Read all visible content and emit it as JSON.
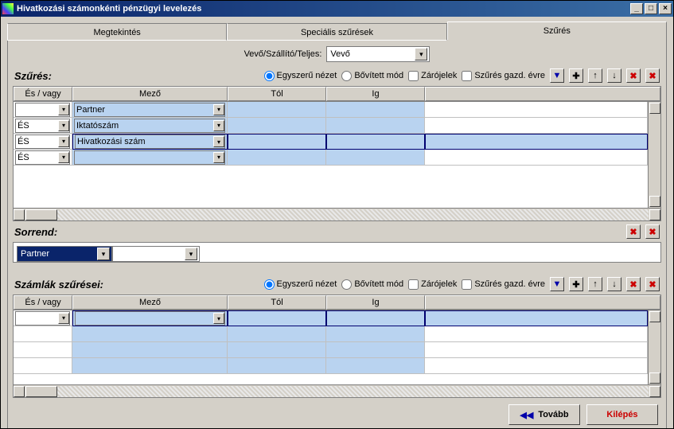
{
  "window": {
    "title": "Hivatkozási számonkénti pénzügyi levelezés"
  },
  "tabs": {
    "view": "Megtekintés",
    "special": "Speciális szűrések",
    "filter": "Szűrés"
  },
  "typeRow": {
    "label": "Vevő/Szállító/Teljes:",
    "value": "Vevő"
  },
  "filterSection": {
    "title": "Szűrés:",
    "viewSimple": "Egyszerű nézet",
    "viewExtended": "Bővített mód",
    "brackets": "Zárójelek",
    "filterYear": "Szűrés gazd. évre",
    "headers": {
      "andor": "És / vagy",
      "field": "Mező",
      "from": "Tól",
      "to": "Ig"
    },
    "rows": [
      {
        "andor": "",
        "field": "Partner"
      },
      {
        "andor": "ÉS",
        "field": "Iktatószám"
      },
      {
        "andor": "ÉS",
        "field": "Hivatkozási szám"
      },
      {
        "andor": "ÉS",
        "field": ""
      }
    ]
  },
  "orderSection": {
    "title": "Sorrend:",
    "field1": "Partner",
    "field2": ""
  },
  "invoiceSection": {
    "title": "Számlák szűrései:",
    "viewSimple": "Egyszerű nézet",
    "viewExtended": "Bővített mód",
    "brackets": "Zárójelek",
    "filterYear": "Szűrés gazd. évre",
    "headers": {
      "andor": "És / vagy",
      "field": "Mező",
      "from": "Tól",
      "to": "Ig"
    },
    "rows": [
      {
        "andor": "",
        "field": ""
      }
    ]
  },
  "buttons": {
    "next": "Tovább",
    "exit": "Kilépés"
  },
  "icons": {
    "down": "▼",
    "plus": "✚",
    "up": "↑",
    "dn": "↓",
    "del": "✖",
    "rewind": "◀◀"
  }
}
